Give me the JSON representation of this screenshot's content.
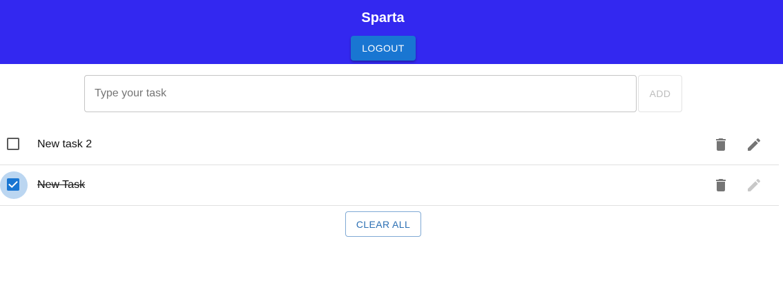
{
  "header": {
    "title": "Sparta",
    "logout_label": "LOGOUT",
    "background_color": "#3328f0"
  },
  "task_form": {
    "placeholder": "Type your task",
    "value": "",
    "add_label": "ADD"
  },
  "tasks": [
    {
      "label": "New task 2",
      "completed": false
    },
    {
      "label": "New Task",
      "completed": true
    }
  ],
  "actions": {
    "clear_all_label": "CLEAR ALL"
  },
  "icons": {
    "delete": "trash-icon",
    "edit": "pencil-icon",
    "check": "check-icon"
  },
  "colors": {
    "primary": "#1976d2",
    "icon": "#757575",
    "icon_disabled": "#c8c8c8"
  }
}
